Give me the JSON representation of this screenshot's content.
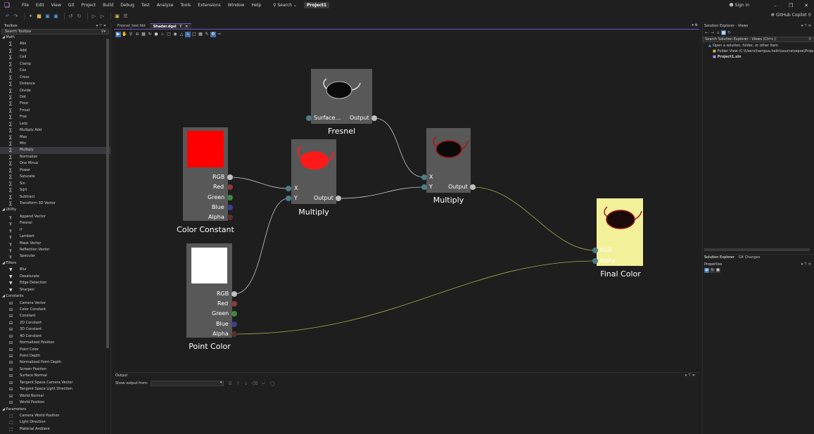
{
  "menu": {
    "items": [
      "File",
      "Edit",
      "View",
      "Git",
      "Project",
      "Build",
      "Debug",
      "Test",
      "Analyze",
      "Tools",
      "Extensions",
      "Window",
      "Help"
    ],
    "search": "Search",
    "project_badge": "Project1",
    "signin": "Sign in",
    "copilot": "GitHub Copilot"
  },
  "toolbox": {
    "title": "Toolbox",
    "search_placeholder": "Search Toolbox",
    "categories": [
      {
        "name": "Math",
        "icon": "sigma-icon",
        "items": [
          "Abs",
          "Add",
          "Ceil",
          "Clamp",
          "Cos",
          "Cross",
          "Distance",
          "Divide",
          "Dot",
          "Floor",
          "Fmod",
          "Frac",
          "Lerp",
          "Multiply Add",
          "Max",
          "Min",
          "Multiply",
          "Normalize",
          "One Minus",
          "Power",
          "Saturate",
          "Sin",
          "Sqrt",
          "Subtract",
          "Transform 3D Vector"
        ]
      },
      {
        "name": "Utility",
        "icon": "utility-icon",
        "items": [
          "Append Vector",
          "Fresnel",
          "If",
          "Lambert",
          "Mask Vector",
          "Reflection Vector",
          "Specular"
        ]
      },
      {
        "name": "Filters",
        "icon": "filter-icon",
        "items": [
          "Blur",
          "Desaturate",
          "Edge Detection",
          "Sharpen"
        ]
      },
      {
        "name": "Constants",
        "icon": "constant-icon",
        "items": [
          "Camera Vector",
          "Color Constant",
          "Constant",
          "2D Constant",
          "3D Constant",
          "4D Constant",
          "Normalized Position",
          "Point Color",
          "Point Depth",
          "Normalized Point Depth",
          "Screen Position",
          "Surface Normal",
          "Tangent Space Camera Vector",
          "Tangent Space Light Direction",
          "World Normal",
          "World Position"
        ]
      },
      {
        "name": "Parameters",
        "icon": "parameter-icon",
        "items": [
          "Camera World Position",
          "Light Direction",
          "Material Ambient"
        ]
      }
    ],
    "selected_item": "Multiply"
  },
  "doc_tabs": [
    {
      "label": "Fresnel_test.fdd",
      "active": false
    },
    {
      "label": "Shader.dgsl",
      "active": true
    }
  ],
  "graph": {
    "nodes": {
      "fresnel": {
        "title": "Fresnel",
        "in_label": "Surface...",
        "out_label": "Output"
      },
      "color_constant": {
        "title": "Color Constant",
        "ports": [
          "RGB",
          "Red",
          "Green",
          "Blue",
          "Alpha"
        ],
        "swatch": "#ff0000"
      },
      "multiply1": {
        "title": "Multiply",
        "in_x": "X",
        "in_y": "Y",
        "out_label": "Output"
      },
      "multiply2": {
        "title": "Multiply",
        "in_x": "X",
        "in_y": "Y",
        "out_label": "Output"
      },
      "point_color": {
        "title": "Point Color",
        "ports": [
          "RGB",
          "Red",
          "Green",
          "Blue",
          "Alpha"
        ],
        "swatch": "#ffffff"
      },
      "final_color": {
        "title": "Final Color",
        "ports": [
          "RGB",
          "Alpha"
        ]
      }
    }
  },
  "output": {
    "title": "Output",
    "show_from": "Show output from:"
  },
  "solution_explorer": {
    "title": "Solution Explorer - Views",
    "search_placeholder": "Search Solution Explorer - Views (Ctrl+;)",
    "items": [
      "Open a solution, folder, or other item",
      "Folder View (C:\\Users\\hampus.helin\\source\\repos\\Proje",
      "Project1.sln"
    ],
    "tabs": [
      "Solution Explorer",
      "Git Changes"
    ]
  },
  "properties": {
    "title": "Properties"
  },
  "colors": {
    "accent": "#6d4fc2",
    "final_node_bg": "#f3f09a",
    "node_bg": "#585858",
    "port_rgb": "#c0c0c0",
    "port_red": "#8b3a3a",
    "port_green": "#3f8a3f",
    "port_blue": "#3f3f8b",
    "port_input": "#4d7c86",
    "wire": "#c8c8c8",
    "wire_final": "#a8a84c"
  }
}
